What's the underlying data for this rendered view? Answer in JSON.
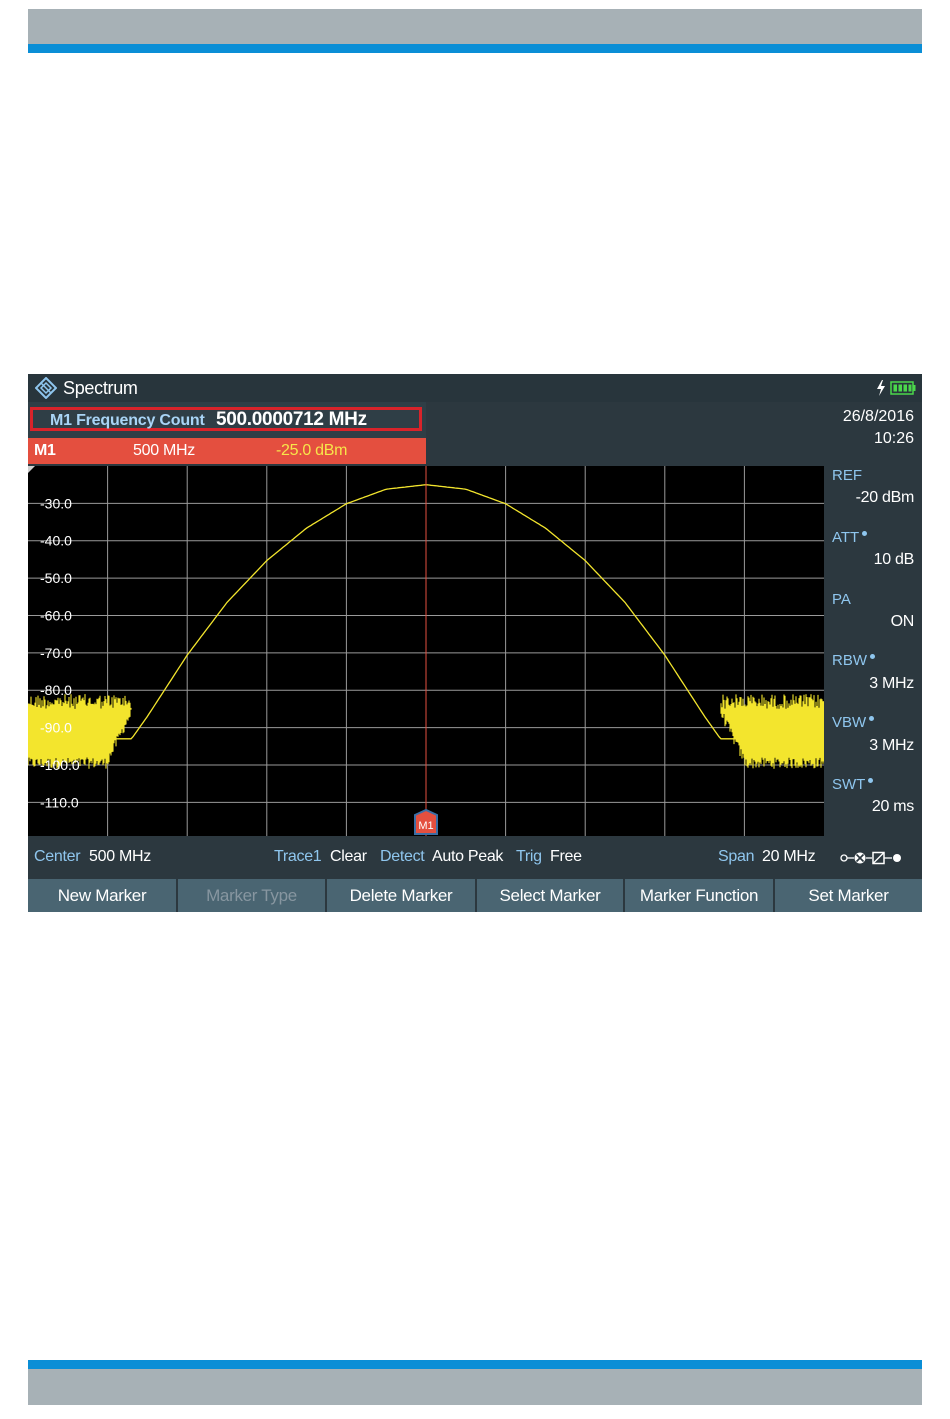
{
  "colors": {
    "page_band_gray": "#a7b1b6",
    "page_band_blue": "#0a8ed6",
    "screen_bg": "#2c383f",
    "label_blue": "#8fc6ee",
    "marker_bar_red": "#e44f3f",
    "highlight_border_red": "#d8232a",
    "trace_yellow": "#f3e52d",
    "softkey_bg": "#4a6572",
    "battery_green": "#4bd84b"
  },
  "titlebar": {
    "title": "Spectrum",
    "logo_icon": "rohde-schwarz-diamond-icon",
    "power_icon": "lightning-icon",
    "battery_icon": "battery-full-icon"
  },
  "frequency_count": {
    "label": "M1 Frequency Count",
    "value": "500.0000712 MHz"
  },
  "marker": {
    "name": "M1",
    "frequency": "500 MHz",
    "level": "-25.0 dBm",
    "flag_label": "M1"
  },
  "side_panel": {
    "date": "26/8/2016",
    "time": "10:26",
    "params": [
      {
        "label": "REF",
        "value": "-20 dBm",
        "dot": false
      },
      {
        "label": "ATT",
        "value": "10 dB",
        "dot": true
      },
      {
        "label": "PA",
        "value": "ON",
        "dot": false
      },
      {
        "label": "RBW",
        "value": "3 MHz",
        "dot": true
      },
      {
        "label": "VBW",
        "value": "3 MHz",
        "dot": true
      },
      {
        "label": "SWT",
        "value": "20 ms",
        "dot": true
      }
    ]
  },
  "status": {
    "center_label": "Center",
    "center_value": "500 MHz",
    "trace_label": "Trace1",
    "trace_value": "Clear",
    "detect_label": "Detect",
    "detect_value": "Auto Peak",
    "trig_label": "Trig",
    "trig_value": "Free",
    "span_label": "Span",
    "span_value": "20 MHz",
    "signal_path_icon": "signal-path-icon"
  },
  "softkeys": [
    {
      "label": "New Marker",
      "enabled": true
    },
    {
      "label": "Marker Type",
      "enabled": false
    },
    {
      "label": "Delete Marker",
      "enabled": true
    },
    {
      "label": "Select Marker",
      "enabled": true
    },
    {
      "label": "Marker Function",
      "enabled": true
    },
    {
      "label": "Set Marker",
      "enabled": true
    }
  ],
  "chart_data": {
    "type": "line",
    "y_tick_labels": [
      "-30.0",
      "-40.0",
      "-50.0",
      "-60.0",
      "-70.0",
      "-80.0",
      "-90.0",
      "-100.0",
      "-110.0"
    ],
    "ylim": [
      -119,
      -20
    ],
    "x_center_mhz": 500,
    "x_span_mhz": 20,
    "xlim_mhz": [
      490,
      510
    ],
    "grid": true,
    "series": [
      {
        "x": [
          490,
          492.6,
          493,
          494,
          495,
          496,
          497,
          498,
          499,
          500,
          501,
          502,
          503,
          504,
          505,
          506,
          507,
          507.4,
          510
        ],
        "y": [
          -93,
          -93,
          -87,
          -70.6,
          -56.5,
          -45.3,
          -36.6,
          -30.1,
          -26.2,
          -25.0,
          -26.2,
          -30.1,
          -36.6,
          -45.3,
          -56.5,
          -70.6,
          -87,
          -93,
          -93
        ],
        "noise_floor_band": [
          -101,
          -81
        ]
      }
    ],
    "marker": {
      "x": 500,
      "y": -25.0
    }
  }
}
